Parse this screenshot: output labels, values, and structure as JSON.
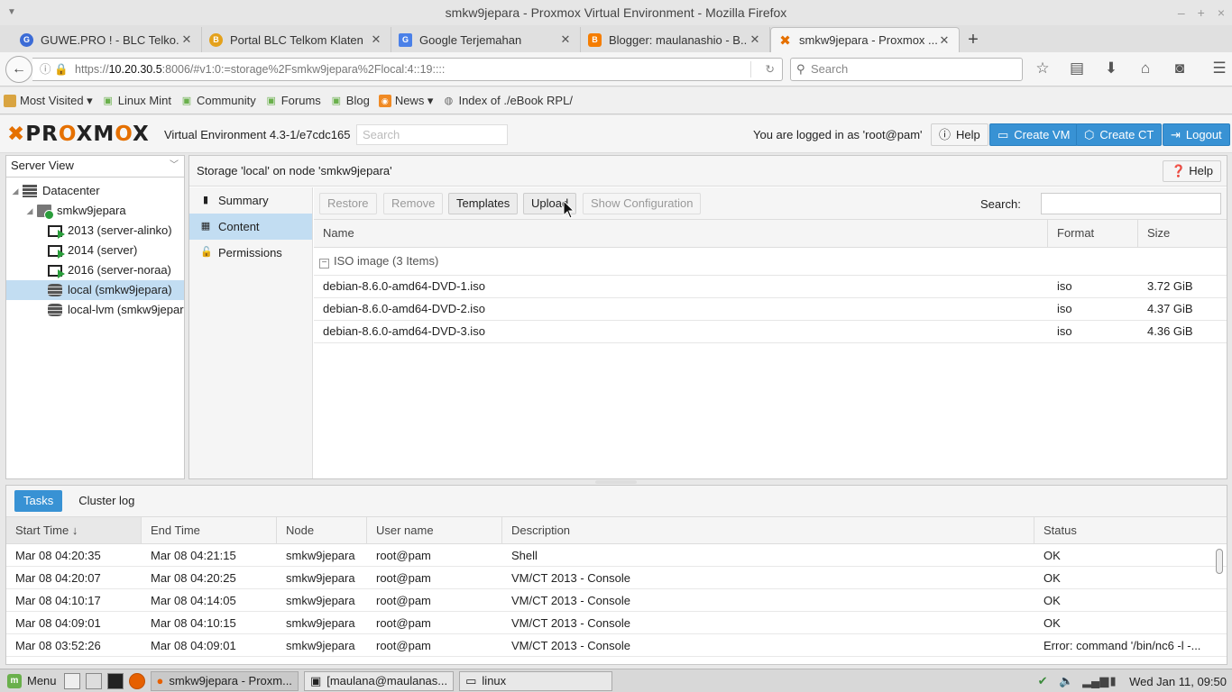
{
  "window": {
    "title": "smkw9jepara - Proxmox Virtual Environment - Mozilla Firefox",
    "controls": [
      "–",
      "+",
      "×"
    ]
  },
  "tabs": [
    {
      "label": "GUWE.PRO ! - BLC Telko...",
      "icon": "guwe-icon",
      "color": "#3b6bd6"
    },
    {
      "label": "Portal BLC Telkom Klaten",
      "icon": "blc-icon",
      "color": "#e4a11b"
    },
    {
      "label": "Google Terjemahan",
      "icon": "translate-icon",
      "color": "#4a80e8"
    },
    {
      "label": "Blogger: maulanashio - B...",
      "icon": "blogger-icon",
      "color": "#f57d00"
    },
    {
      "label": "smkw9jepara - Proxmox ...",
      "icon": "proxmox-icon",
      "color": "#e57000"
    }
  ],
  "nav": {
    "url_prefix": "https://",
    "url_host": "10.20.30.5",
    "url_rest": ":8006/#v1:0:=storage%2Fsmkw9jepara%2Flocal:4::19::::",
    "search_placeholder": "Search"
  },
  "bookmarks": [
    {
      "label": "Most Visited ▾",
      "icon": "bookmark-folder-icon"
    },
    {
      "label": "Linux Mint",
      "icon": "mint-icon"
    },
    {
      "label": "Community",
      "icon": "mint-icon"
    },
    {
      "label": "Forums",
      "icon": "mint-icon"
    },
    {
      "label": "Blog",
      "icon": "mint-icon"
    },
    {
      "label": "News ▾",
      "icon": "rss-icon"
    },
    {
      "label": "Index of ./eBook RPL/",
      "icon": "globe-icon"
    }
  ],
  "pve": {
    "logo_pre": "PR",
    "logo_ox": "O",
    "logo_mid": "XM",
    "logo_ox2": "O",
    "logo_end": "X",
    "version": "Virtual Environment 4.3-1/e7cdc165",
    "search_placeholder": "Search",
    "logged_in": "You are logged in as 'root@pam'",
    "help": "Help",
    "create_vm": "Create VM",
    "create_ct": "Create CT",
    "logout": "Logout"
  },
  "tree": {
    "view": "Server View",
    "items": [
      {
        "label": "Datacenter",
        "level": 0,
        "icon": "datacenter-icon"
      },
      {
        "label": "smkw9jepara",
        "level": 1,
        "icon": "node-icon"
      },
      {
        "label": "2013 (server-alinko)",
        "level": 2,
        "icon": "vm-icon"
      },
      {
        "label": "2014 (server)",
        "level": 2,
        "icon": "vm-icon"
      },
      {
        "label": "2016 (server-noraa)",
        "level": 2,
        "icon": "vm-icon"
      },
      {
        "label": "local (smkw9jepara)",
        "level": 2,
        "icon": "storage-icon"
      },
      {
        "label": "local-lvm (smkw9jepara)",
        "level": 2,
        "icon": "storage-icon"
      }
    ]
  },
  "panel": {
    "title": "Storage 'local' on node 'smkw9jepara'",
    "help": "Help",
    "subnav": [
      {
        "label": "Summary",
        "icon": "book-icon"
      },
      {
        "label": "Content",
        "icon": "grid-icon"
      },
      {
        "label": "Permissions",
        "icon": "unlock-icon"
      }
    ],
    "toolbar": {
      "restore": "Restore",
      "remove": "Remove",
      "templates": "Templates",
      "upload": "Upload",
      "show_config": "Show Configuration",
      "search_label": "Search:"
    },
    "columns": [
      "Name",
      "Format",
      "Size"
    ],
    "group": "ISO image (3 Items)",
    "rows": [
      {
        "name": "debian-8.6.0-amd64-DVD-1.iso",
        "format": "iso",
        "size": "3.72 GiB"
      },
      {
        "name": "debian-8.6.0-amd64-DVD-2.iso",
        "format": "iso",
        "size": "4.37 GiB"
      },
      {
        "name": "debian-8.6.0-amd64-DVD-3.iso",
        "format": "iso",
        "size": "4.36 GiB"
      }
    ]
  },
  "tasks": {
    "tab_tasks": "Tasks",
    "tab_cluster": "Cluster log",
    "columns": [
      "Start Time ↓",
      "End Time",
      "Node",
      "User name",
      "Description",
      "Status"
    ],
    "rows": [
      {
        "start": "Mar 08 04:20:35",
        "end": "Mar 08 04:21:15",
        "node": "smkw9jepara",
        "user": "root@pam",
        "desc": "Shell",
        "status": "OK"
      },
      {
        "start": "Mar 08 04:20:07",
        "end": "Mar 08 04:20:25",
        "node": "smkw9jepara",
        "user": "root@pam",
        "desc": "VM/CT 2013 - Console",
        "status": "OK"
      },
      {
        "start": "Mar 08 04:10:17",
        "end": "Mar 08 04:14:05",
        "node": "smkw9jepara",
        "user": "root@pam",
        "desc": "VM/CT 2013 - Console",
        "status": "OK"
      },
      {
        "start": "Mar 08 04:09:01",
        "end": "Mar 08 04:10:15",
        "node": "smkw9jepara",
        "user": "root@pam",
        "desc": "VM/CT 2013 - Console",
        "status": "OK"
      },
      {
        "start": "Mar 08 03:52:26",
        "end": "Mar 08 04:09:01",
        "node": "smkw9jepara",
        "user": "root@pam",
        "desc": "VM/CT 2013 - Console",
        "status": "Error: command '/bin/nc6 -l -..."
      }
    ]
  },
  "taskbar": {
    "menu": "Menu",
    "windows": [
      {
        "label": "smkw9jepara - Proxm...",
        "icon": "firefox-icon"
      },
      {
        "label": "[maulana@maulanas...",
        "icon": "terminal-icon"
      },
      {
        "label": "linux",
        "icon": "folder-icon"
      }
    ],
    "clock": "Wed Jan 11, 09:50"
  }
}
